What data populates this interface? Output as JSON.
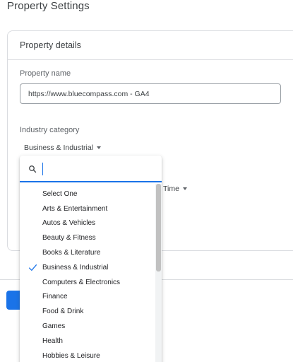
{
  "page": {
    "title": "Property Settings"
  },
  "card": {
    "title": "Property details",
    "property_name": {
      "label": "Property name",
      "value": "https://www.bluecompass.com - GA4"
    },
    "industry": {
      "label": "Industry category",
      "selected": "Business & Industrial"
    },
    "time_select_label": "Time"
  },
  "dropdown": {
    "search_icon": "search-icon",
    "search_value": "",
    "options": [
      {
        "label": "Select One",
        "checked": false
      },
      {
        "label": "Arts & Entertainment",
        "checked": false
      },
      {
        "label": "Autos & Vehicles",
        "checked": false
      },
      {
        "label": "Beauty & Fitness",
        "checked": false
      },
      {
        "label": "Books & Literature",
        "checked": false
      },
      {
        "label": "Business & Industrial",
        "checked": true
      },
      {
        "label": "Computers & Electronics",
        "checked": false
      },
      {
        "label": "Finance",
        "checked": false
      },
      {
        "label": "Food & Drink",
        "checked": false
      },
      {
        "label": "Games",
        "checked": false
      },
      {
        "label": "Health",
        "checked": false
      },
      {
        "label": "Hobbies & Leisure",
        "checked": false
      }
    ]
  },
  "colors": {
    "accent": "#1a73e8",
    "border": "#dadce0",
    "text": "#202124",
    "muted_text": "#5f6368"
  }
}
